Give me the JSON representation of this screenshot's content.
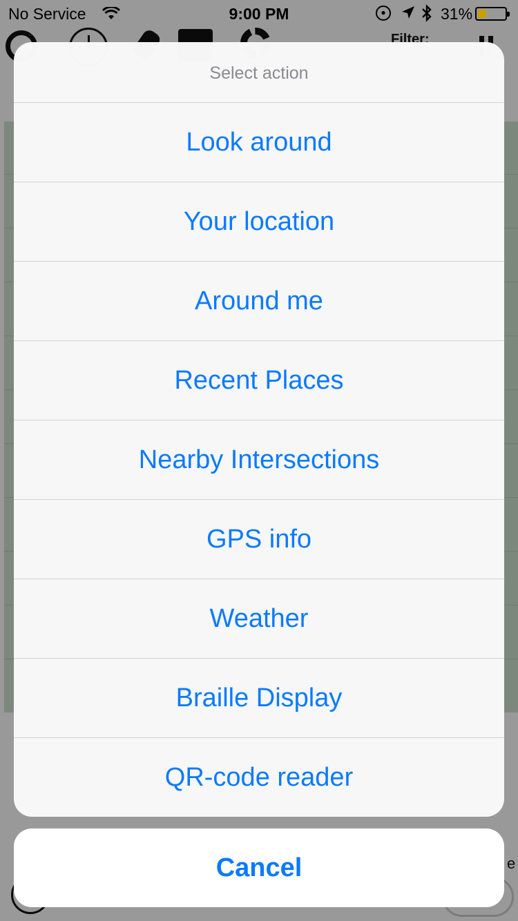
{
  "status_bar": {
    "carrier": "No Service",
    "time": "9:00 PM",
    "battery_percent": "31%",
    "battery_level": 0.31,
    "icons": [
      "wifi-icon",
      "orientation-lock-icon",
      "location-arrow-icon",
      "bluetooth-icon",
      "battery-icon"
    ]
  },
  "background_app": {
    "filter_label": "Filter:",
    "toolbar_icons": [
      "search-icon",
      "clock-icon",
      "wrench-icon",
      "checkbox-icon",
      "gear-icon",
      "pause-icon"
    ]
  },
  "action_sheet": {
    "title": "Select action",
    "items": [
      {
        "label": "Look around"
      },
      {
        "label": "Your location"
      },
      {
        "label": "Around me"
      },
      {
        "label": "Recent Places"
      },
      {
        "label": "Nearby Intersections"
      },
      {
        "label": "GPS info"
      },
      {
        "label": "Weather"
      },
      {
        "label": "Braille Display"
      },
      {
        "label": "QR-code reader"
      }
    ],
    "cancel_label": "Cancel"
  },
  "colors": {
    "accent": "#0a7aff",
    "sheet_background": "#f8f8f8",
    "title_gray": "#8a8a8f",
    "battery_fill": "#c79f00"
  }
}
